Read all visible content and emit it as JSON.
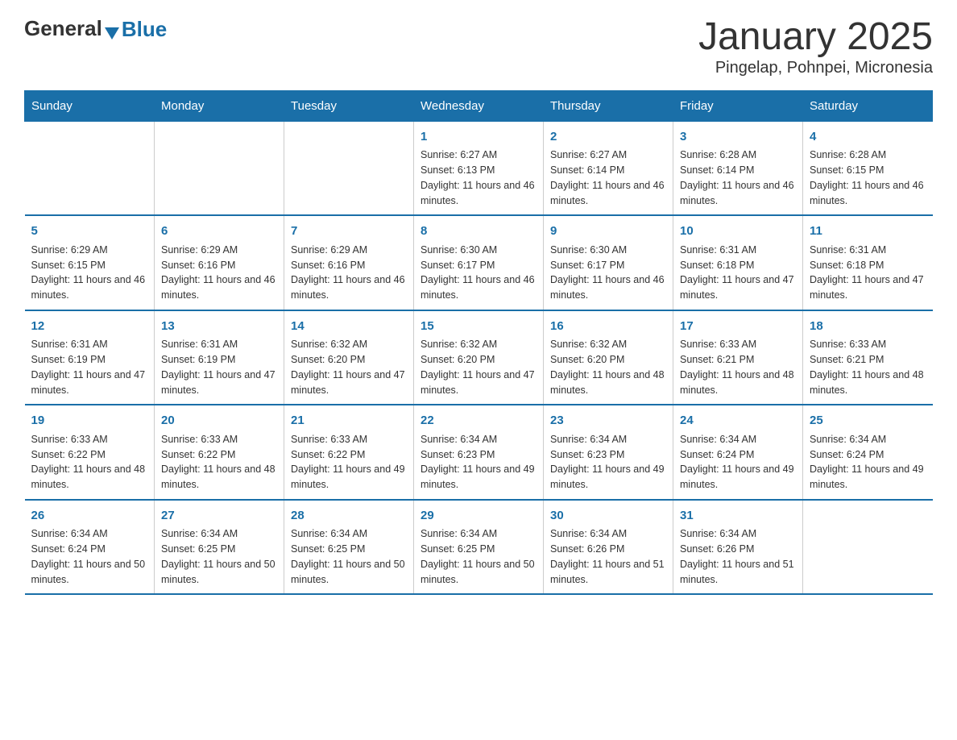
{
  "header": {
    "logo_text_general": "General",
    "logo_text_blue": "Blue",
    "title": "January 2025",
    "subtitle": "Pingelap, Pohnpei, Micronesia"
  },
  "calendar": {
    "days_of_week": [
      "Sunday",
      "Monday",
      "Tuesday",
      "Wednesday",
      "Thursday",
      "Friday",
      "Saturday"
    ],
    "weeks": [
      [
        {
          "day": "",
          "info": ""
        },
        {
          "day": "",
          "info": ""
        },
        {
          "day": "",
          "info": ""
        },
        {
          "day": "1",
          "info": "Sunrise: 6:27 AM\nSunset: 6:13 PM\nDaylight: 11 hours and 46 minutes."
        },
        {
          "day": "2",
          "info": "Sunrise: 6:27 AM\nSunset: 6:14 PM\nDaylight: 11 hours and 46 minutes."
        },
        {
          "day": "3",
          "info": "Sunrise: 6:28 AM\nSunset: 6:14 PM\nDaylight: 11 hours and 46 minutes."
        },
        {
          "day": "4",
          "info": "Sunrise: 6:28 AM\nSunset: 6:15 PM\nDaylight: 11 hours and 46 minutes."
        }
      ],
      [
        {
          "day": "5",
          "info": "Sunrise: 6:29 AM\nSunset: 6:15 PM\nDaylight: 11 hours and 46 minutes."
        },
        {
          "day": "6",
          "info": "Sunrise: 6:29 AM\nSunset: 6:16 PM\nDaylight: 11 hours and 46 minutes."
        },
        {
          "day": "7",
          "info": "Sunrise: 6:29 AM\nSunset: 6:16 PM\nDaylight: 11 hours and 46 minutes."
        },
        {
          "day": "8",
          "info": "Sunrise: 6:30 AM\nSunset: 6:17 PM\nDaylight: 11 hours and 46 minutes."
        },
        {
          "day": "9",
          "info": "Sunrise: 6:30 AM\nSunset: 6:17 PM\nDaylight: 11 hours and 46 minutes."
        },
        {
          "day": "10",
          "info": "Sunrise: 6:31 AM\nSunset: 6:18 PM\nDaylight: 11 hours and 47 minutes."
        },
        {
          "day": "11",
          "info": "Sunrise: 6:31 AM\nSunset: 6:18 PM\nDaylight: 11 hours and 47 minutes."
        }
      ],
      [
        {
          "day": "12",
          "info": "Sunrise: 6:31 AM\nSunset: 6:19 PM\nDaylight: 11 hours and 47 minutes."
        },
        {
          "day": "13",
          "info": "Sunrise: 6:31 AM\nSunset: 6:19 PM\nDaylight: 11 hours and 47 minutes."
        },
        {
          "day": "14",
          "info": "Sunrise: 6:32 AM\nSunset: 6:20 PM\nDaylight: 11 hours and 47 minutes."
        },
        {
          "day": "15",
          "info": "Sunrise: 6:32 AM\nSunset: 6:20 PM\nDaylight: 11 hours and 47 minutes."
        },
        {
          "day": "16",
          "info": "Sunrise: 6:32 AM\nSunset: 6:20 PM\nDaylight: 11 hours and 48 minutes."
        },
        {
          "day": "17",
          "info": "Sunrise: 6:33 AM\nSunset: 6:21 PM\nDaylight: 11 hours and 48 minutes."
        },
        {
          "day": "18",
          "info": "Sunrise: 6:33 AM\nSunset: 6:21 PM\nDaylight: 11 hours and 48 minutes."
        }
      ],
      [
        {
          "day": "19",
          "info": "Sunrise: 6:33 AM\nSunset: 6:22 PM\nDaylight: 11 hours and 48 minutes."
        },
        {
          "day": "20",
          "info": "Sunrise: 6:33 AM\nSunset: 6:22 PM\nDaylight: 11 hours and 48 minutes."
        },
        {
          "day": "21",
          "info": "Sunrise: 6:33 AM\nSunset: 6:22 PM\nDaylight: 11 hours and 49 minutes."
        },
        {
          "day": "22",
          "info": "Sunrise: 6:34 AM\nSunset: 6:23 PM\nDaylight: 11 hours and 49 minutes."
        },
        {
          "day": "23",
          "info": "Sunrise: 6:34 AM\nSunset: 6:23 PM\nDaylight: 11 hours and 49 minutes."
        },
        {
          "day": "24",
          "info": "Sunrise: 6:34 AM\nSunset: 6:24 PM\nDaylight: 11 hours and 49 minutes."
        },
        {
          "day": "25",
          "info": "Sunrise: 6:34 AM\nSunset: 6:24 PM\nDaylight: 11 hours and 49 minutes."
        }
      ],
      [
        {
          "day": "26",
          "info": "Sunrise: 6:34 AM\nSunset: 6:24 PM\nDaylight: 11 hours and 50 minutes."
        },
        {
          "day": "27",
          "info": "Sunrise: 6:34 AM\nSunset: 6:25 PM\nDaylight: 11 hours and 50 minutes."
        },
        {
          "day": "28",
          "info": "Sunrise: 6:34 AM\nSunset: 6:25 PM\nDaylight: 11 hours and 50 minutes."
        },
        {
          "day": "29",
          "info": "Sunrise: 6:34 AM\nSunset: 6:25 PM\nDaylight: 11 hours and 50 minutes."
        },
        {
          "day": "30",
          "info": "Sunrise: 6:34 AM\nSunset: 6:26 PM\nDaylight: 11 hours and 51 minutes."
        },
        {
          "day": "31",
          "info": "Sunrise: 6:34 AM\nSunset: 6:26 PM\nDaylight: 11 hours and 51 minutes."
        },
        {
          "day": "",
          "info": ""
        }
      ]
    ]
  }
}
